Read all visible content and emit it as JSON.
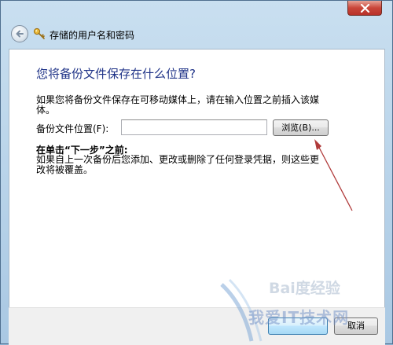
{
  "window": {
    "title": "存储的用户名和密码",
    "close_icon": "close-x-icon",
    "back_icon": "back-arrow-icon",
    "title_icon": "key-icon"
  },
  "main": {
    "heading": "您将备份文件保存在什么位置?",
    "description": "如果您将备份文件保存在可移动媒体上，请在输入位置之前插入该媒体。",
    "location_label": "备份文件位置(F):",
    "location_value": "",
    "browse_label": "浏览(B)...",
    "before_next_title": "在单击“下一步”之前:",
    "before_next_text": "如果自上一次备份后您添加、更改或删除了任何登录凭据，则这些更改将被覆盖。"
  },
  "footer": {
    "next_label": "",
    "cancel_label": "取消"
  },
  "watermark": {
    "baidu_text": "Bai度经验",
    "site_text": "我爱IT技术网"
  },
  "colors": {
    "heading": "#1e3287",
    "annotation_arrow": "#b03a3a",
    "close_button": "#c9463a"
  }
}
